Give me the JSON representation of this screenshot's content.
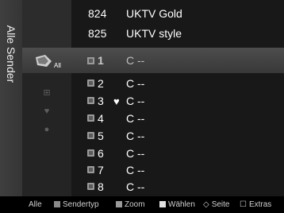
{
  "sidebar": {
    "title": "Alle Sender"
  },
  "categories": {
    "all_label": "All",
    "items": [
      {
        "icon": "added-channels-icon",
        "glyph": "⊞"
      },
      {
        "icon": "favorites-heart-icon",
        "glyph": "♥"
      },
      {
        "icon": "globe-icon",
        "glyph": "●"
      }
    ]
  },
  "channels_top": [
    {
      "number": "824",
      "name": "UKTV Gold"
    },
    {
      "number": "825",
      "name": "UKTV style"
    }
  ],
  "selected_channel": {
    "number": "1",
    "name": "C --"
  },
  "channels": [
    {
      "number": "2",
      "name": "C --",
      "favorite": ""
    },
    {
      "number": "3",
      "name": "C --",
      "favorite": "♥"
    },
    {
      "number": "4",
      "name": "C --",
      "favorite": ""
    },
    {
      "number": "5",
      "name": "C --",
      "favorite": ""
    },
    {
      "number": "6",
      "name": "C --",
      "favorite": ""
    },
    {
      "number": "7",
      "name": "C --",
      "favorite": ""
    },
    {
      "number": "8",
      "name": "C --",
      "favorite": ""
    }
  ],
  "footer": {
    "mode": "Alle",
    "red": "Sendertyp",
    "green": "Zoom",
    "yellow": "Wählen",
    "page": "Seite",
    "tools": "Extras",
    "colors": {
      "red": "#8a8a8a",
      "green": "#9a9a9a",
      "yellow": "#e0e0e0"
    }
  }
}
